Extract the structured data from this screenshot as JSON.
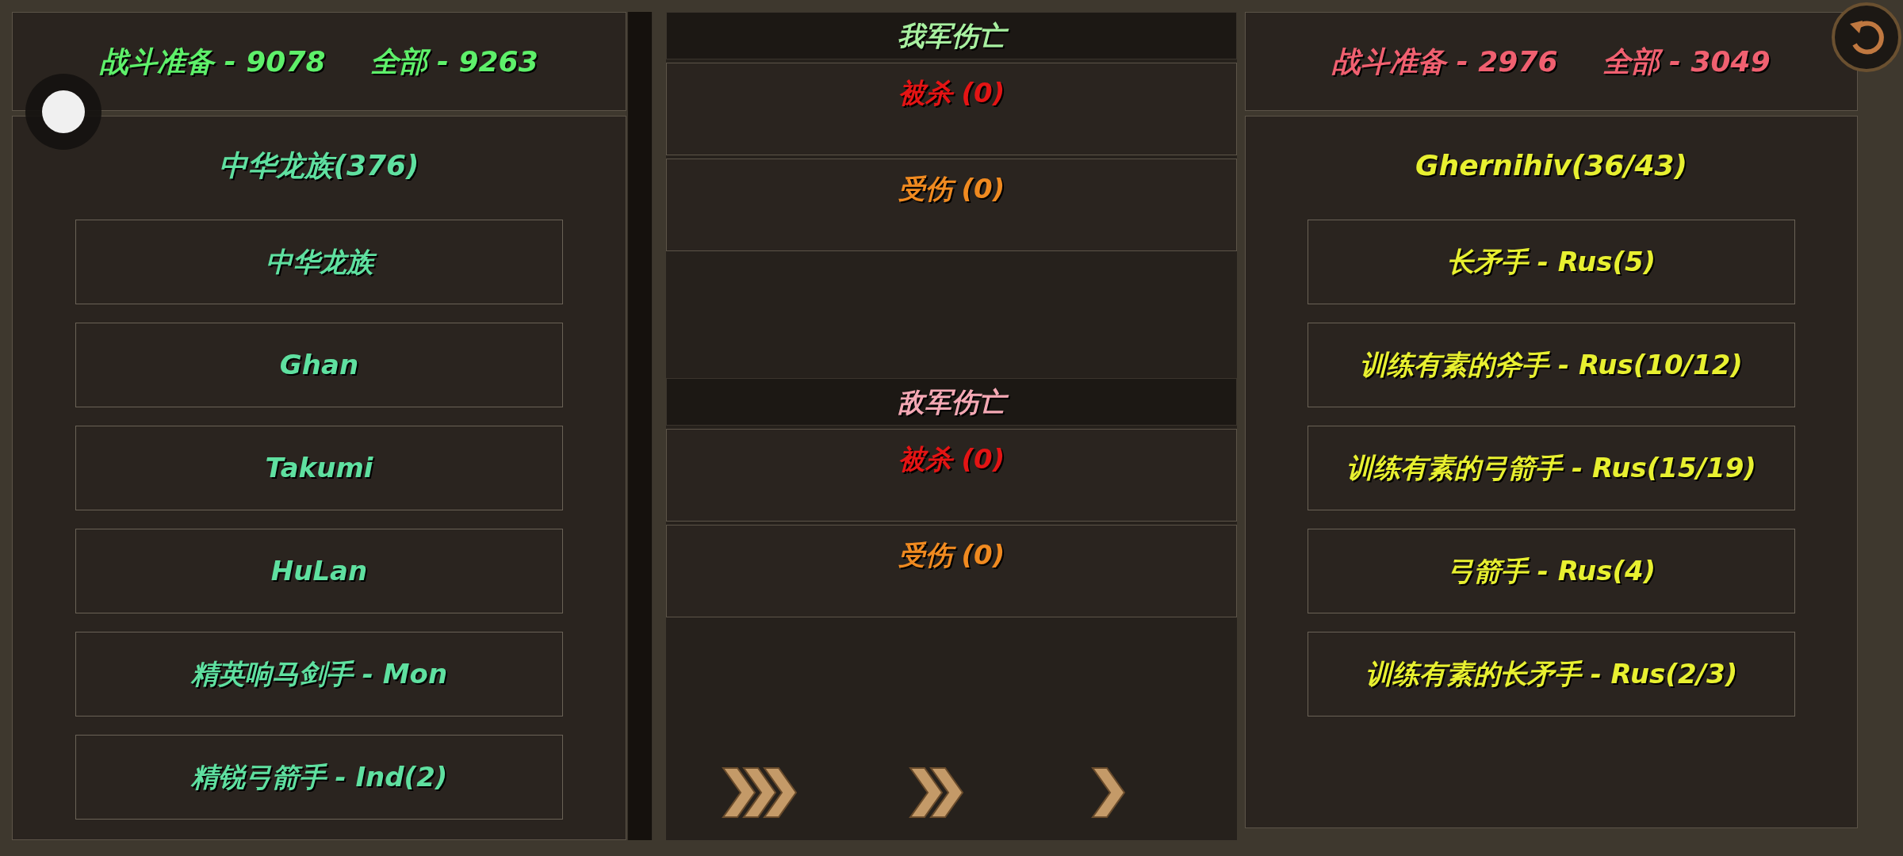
{
  "allies": {
    "kind": "ally",
    "ready": "战斗准备 - 9078",
    "total": "全部 - 9263",
    "group": "中华龙族(376)",
    "units": [
      {
        "label": "中华龙族"
      },
      {
        "label": "Ghan"
      },
      {
        "label": "Takumi"
      },
      {
        "label": "HuLan"
      },
      {
        "label": "精英响马剑手 - Mon"
      },
      {
        "label": "精锐弓箭手 - Ind(2)"
      }
    ]
  },
  "casualties": [
    {
      "title": "我军伤亡",
      "kind": "ally",
      "rows": [
        {
          "kind": "killed",
          "label": "被杀 (0)"
        },
        {
          "kind": "wounded",
          "label": "受伤 (0)"
        }
      ]
    },
    {
      "title": "敌军伤亡",
      "kind": "enemy",
      "rows": [
        {
          "kind": "killed",
          "label": "被杀 (0)"
        },
        {
          "kind": "wounded",
          "label": "受伤 (0)"
        }
      ]
    }
  ],
  "speed_buttons": [
    {
      "kind": "fastest"
    },
    {
      "kind": "fast"
    },
    {
      "kind": "normal"
    }
  ],
  "enemies": {
    "kind": "enemy",
    "ready": "战斗准备 - 2976",
    "total": "全部 - 3049",
    "group": "Ghernihiv(36/43)",
    "units": [
      {
        "label": "长矛手 - Rus(5)"
      },
      {
        "label": "训练有素的斧手 - Rus(10/12)"
      },
      {
        "label": "训练有素的弓箭手 - Rus(15/19)"
      },
      {
        "label": "弓箭手 - Rus(4)"
      },
      {
        "label": "训练有素的长矛手 - Rus(2/3)"
      }
    ]
  }
}
